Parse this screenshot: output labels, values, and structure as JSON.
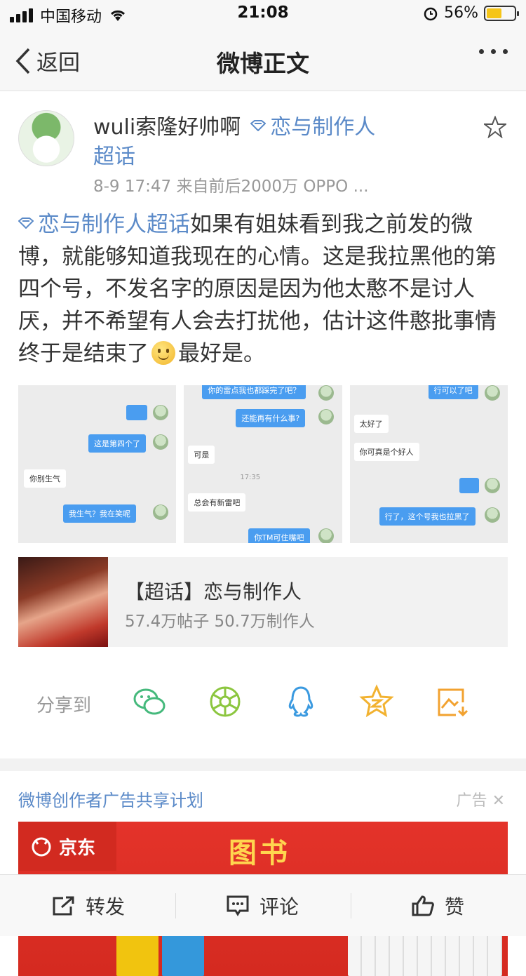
{
  "status_bar": {
    "carrier": "中国移动",
    "time": "21:08",
    "battery": "56%",
    "battery_fraction": 0.56
  },
  "nav": {
    "back_label": "返回",
    "title": "微博正文"
  },
  "post": {
    "author_name": "wuli索隆好帅啊",
    "topic_tag_line1": "恋与制作人",
    "topic_tag_line2": "超话",
    "meta": "8-9 17:47  来自前后2000万 OPPO ...",
    "topic_link": "恋与制作人超话",
    "text_part1": "如果有姐妹看到我之前发的微博，就能够知道我现在的心情。这是我拉黑他的第四个号，不发名字的原因是因为他太憨不是讨人厌，并不希望有人会去打扰他，估计这件憨批事情终于是结束了",
    "text_part2": "最好是。"
  },
  "photos": [
    {
      "bubbles": [
        "这是第四个了",
        "你别生气",
        "我生气？我在笑呢"
      ]
    },
    {
      "bubbles": [
        "你的雷点我也都踩完了吧？",
        "还能再有什么事?",
        "可是",
        "17:35",
        "总会有新雷吧",
        "你TM可住嘴吧"
      ]
    },
    {
      "bubbles": [
        "行可以了吧",
        "太好了",
        "你可真是个好人",
        "行了，这个号我也拉黑了"
      ]
    }
  ],
  "topic_card": {
    "name": "【超话】恋与制作人",
    "stats": "57.4万帖子 50.7万制作人"
  },
  "share": {
    "label": "分享到",
    "icons": [
      "wechat-icon",
      "moments-icon",
      "qq-icon",
      "qzone-icon",
      "save-image-icon"
    ]
  },
  "ad": {
    "title": "微博创作者广告共享计划",
    "tag": "广告",
    "brand": "京东",
    "headline": "图书"
  },
  "bottom_bar": {
    "repost": "转发",
    "comment": "评论",
    "like": "赞"
  },
  "colors": {
    "link": "#5b8ac8",
    "accent_blue": "#4a9df0",
    "ad_red": "#e4332a"
  }
}
